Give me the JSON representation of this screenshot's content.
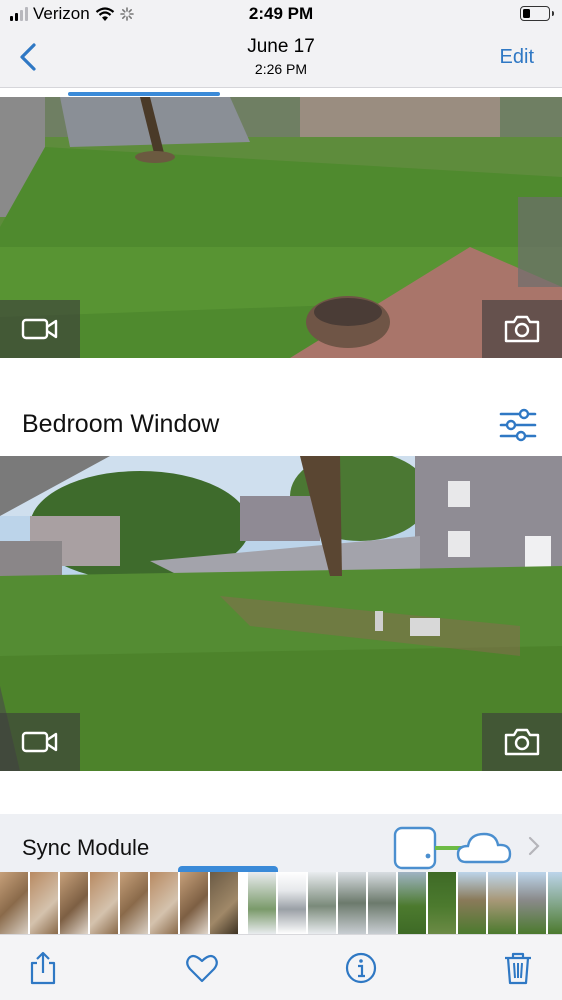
{
  "status_bar": {
    "carrier": "Verizon",
    "time": "2:49 PM",
    "battery_level": 0.3
  },
  "nav": {
    "date": "June 17",
    "time": "2:26 PM",
    "edit_label": "Edit"
  },
  "cameras": [
    {
      "name": ""
    },
    {
      "name": "Bedroom Window"
    }
  ],
  "sync_module": {
    "label": "Sync Module"
  },
  "icons": {
    "back": "chevron-left-icon",
    "video": "video-camera-icon",
    "snapshot": "camera-icon",
    "settings": "sliders-icon",
    "share": "share-icon",
    "favorite": "heart-icon",
    "info": "info-icon",
    "delete": "trash-icon"
  },
  "colors": {
    "accent": "#2f78c4",
    "sync_line": "#6dbb45"
  }
}
